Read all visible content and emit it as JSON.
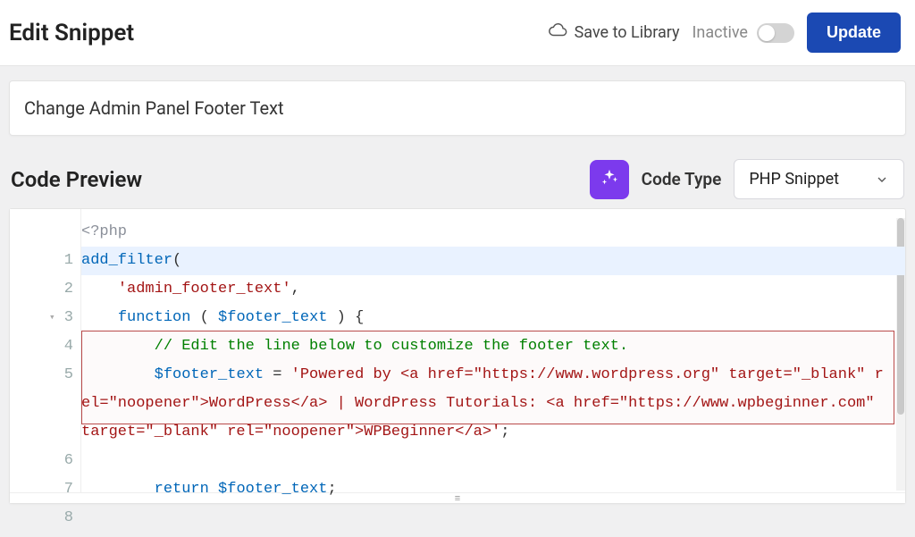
{
  "header": {
    "title": "Edit Snippet",
    "save_library": "Save to Library",
    "inactive_label": "Inactive",
    "update_label": "Update"
  },
  "snippet": {
    "name": "Change Admin Panel Footer Text"
  },
  "section": {
    "preview_title": "Code Preview",
    "code_type_label": "Code Type",
    "code_type_value": "PHP Snippet"
  },
  "code": {
    "phptag": "<?php",
    "line1_fn": "add_filter",
    "line1_p": "(",
    "line2_str": "'admin_footer_text'",
    "line2_p": ",",
    "line3_kw": "function",
    "line3_par_open": " ( ",
    "line3_var": "$footer_text",
    "line3_par_close": " ) {",
    "line4_cmt": "// Edit the line below to customize the footer text.",
    "line5_var": "$footer_text",
    "line5_eq": " = ",
    "line5_str": "'Powered by <a href=\"https://www.wordpress.org\" target=\"_blank\" rel=\"noopener\">WordPress</a> | WordPress Tutorials: <a href=\"https://www.wpbeginner.com\" target=\"_blank\" rel=\"noopener\">WPBeginner</a>'",
    "line5_semi": ";",
    "line7_kw": "return",
    "line7_var": " $footer_text",
    "line7_semi": ";",
    "line8_close": "}"
  }
}
